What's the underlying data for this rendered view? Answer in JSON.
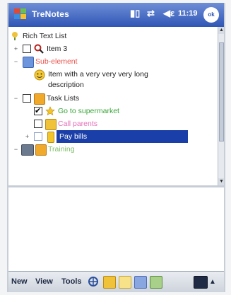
{
  "titlebar": {
    "app_title": "TreNotes",
    "clock": "11:19",
    "ok_label": "ok",
    "icons": [
      "windows-start-icon",
      "signal-icon",
      "connectivity-icon",
      "volume-icon"
    ]
  },
  "tree": {
    "items": [
      {
        "label": "Rich Text List",
        "color": "#222222"
      },
      {
        "label": "Item 3",
        "color": "#222222"
      },
      {
        "label": "Sub-element",
        "color": "#e8554e"
      },
      {
        "label": "Item with a very very very long",
        "label2": "description",
        "color": "#222222"
      },
      {
        "label": "Task Lists",
        "color": "#222222"
      },
      {
        "label": "Go to supermarket",
        "color": "#3aa53a"
      },
      {
        "label": "Call parents",
        "color": "#e46fb9"
      },
      {
        "label": "Pay bills",
        "color": "#ffffff"
      },
      {
        "label": "Training",
        "color": "#7fbf6a"
      }
    ]
  },
  "menubar": {
    "new_label": "New",
    "view_label": "View",
    "tools_label": "Tools"
  },
  "colors": {
    "titlebar": "#2f56b6",
    "selection": "#1b3fa8",
    "accent": "#f0a92a"
  }
}
